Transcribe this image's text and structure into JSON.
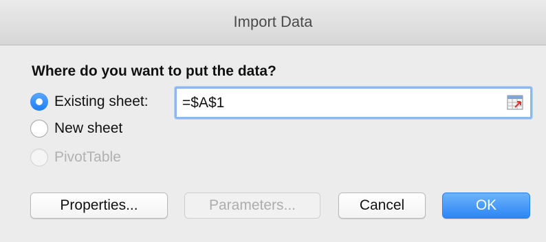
{
  "window": {
    "title": "Import Data"
  },
  "prompt": {
    "question": "Where do you want to put the data?"
  },
  "options": [
    {
      "label": "Existing sheet:",
      "selected": true,
      "enabled": true
    },
    {
      "label": "New sheet",
      "selected": false,
      "enabled": true
    },
    {
      "label": "PivotTable",
      "selected": false,
      "enabled": false
    }
  ],
  "reference": {
    "value": "=$A$1",
    "collapse_icon": "range-selector-icon"
  },
  "buttons": {
    "properties": "Properties...",
    "parameters": "Parameters...",
    "cancel": "Cancel",
    "ok": "OK"
  },
  "colors": {
    "accent": "#1c7ff1",
    "primary_button": "#2c86f5",
    "focus_ring": "#8cb8f2"
  }
}
